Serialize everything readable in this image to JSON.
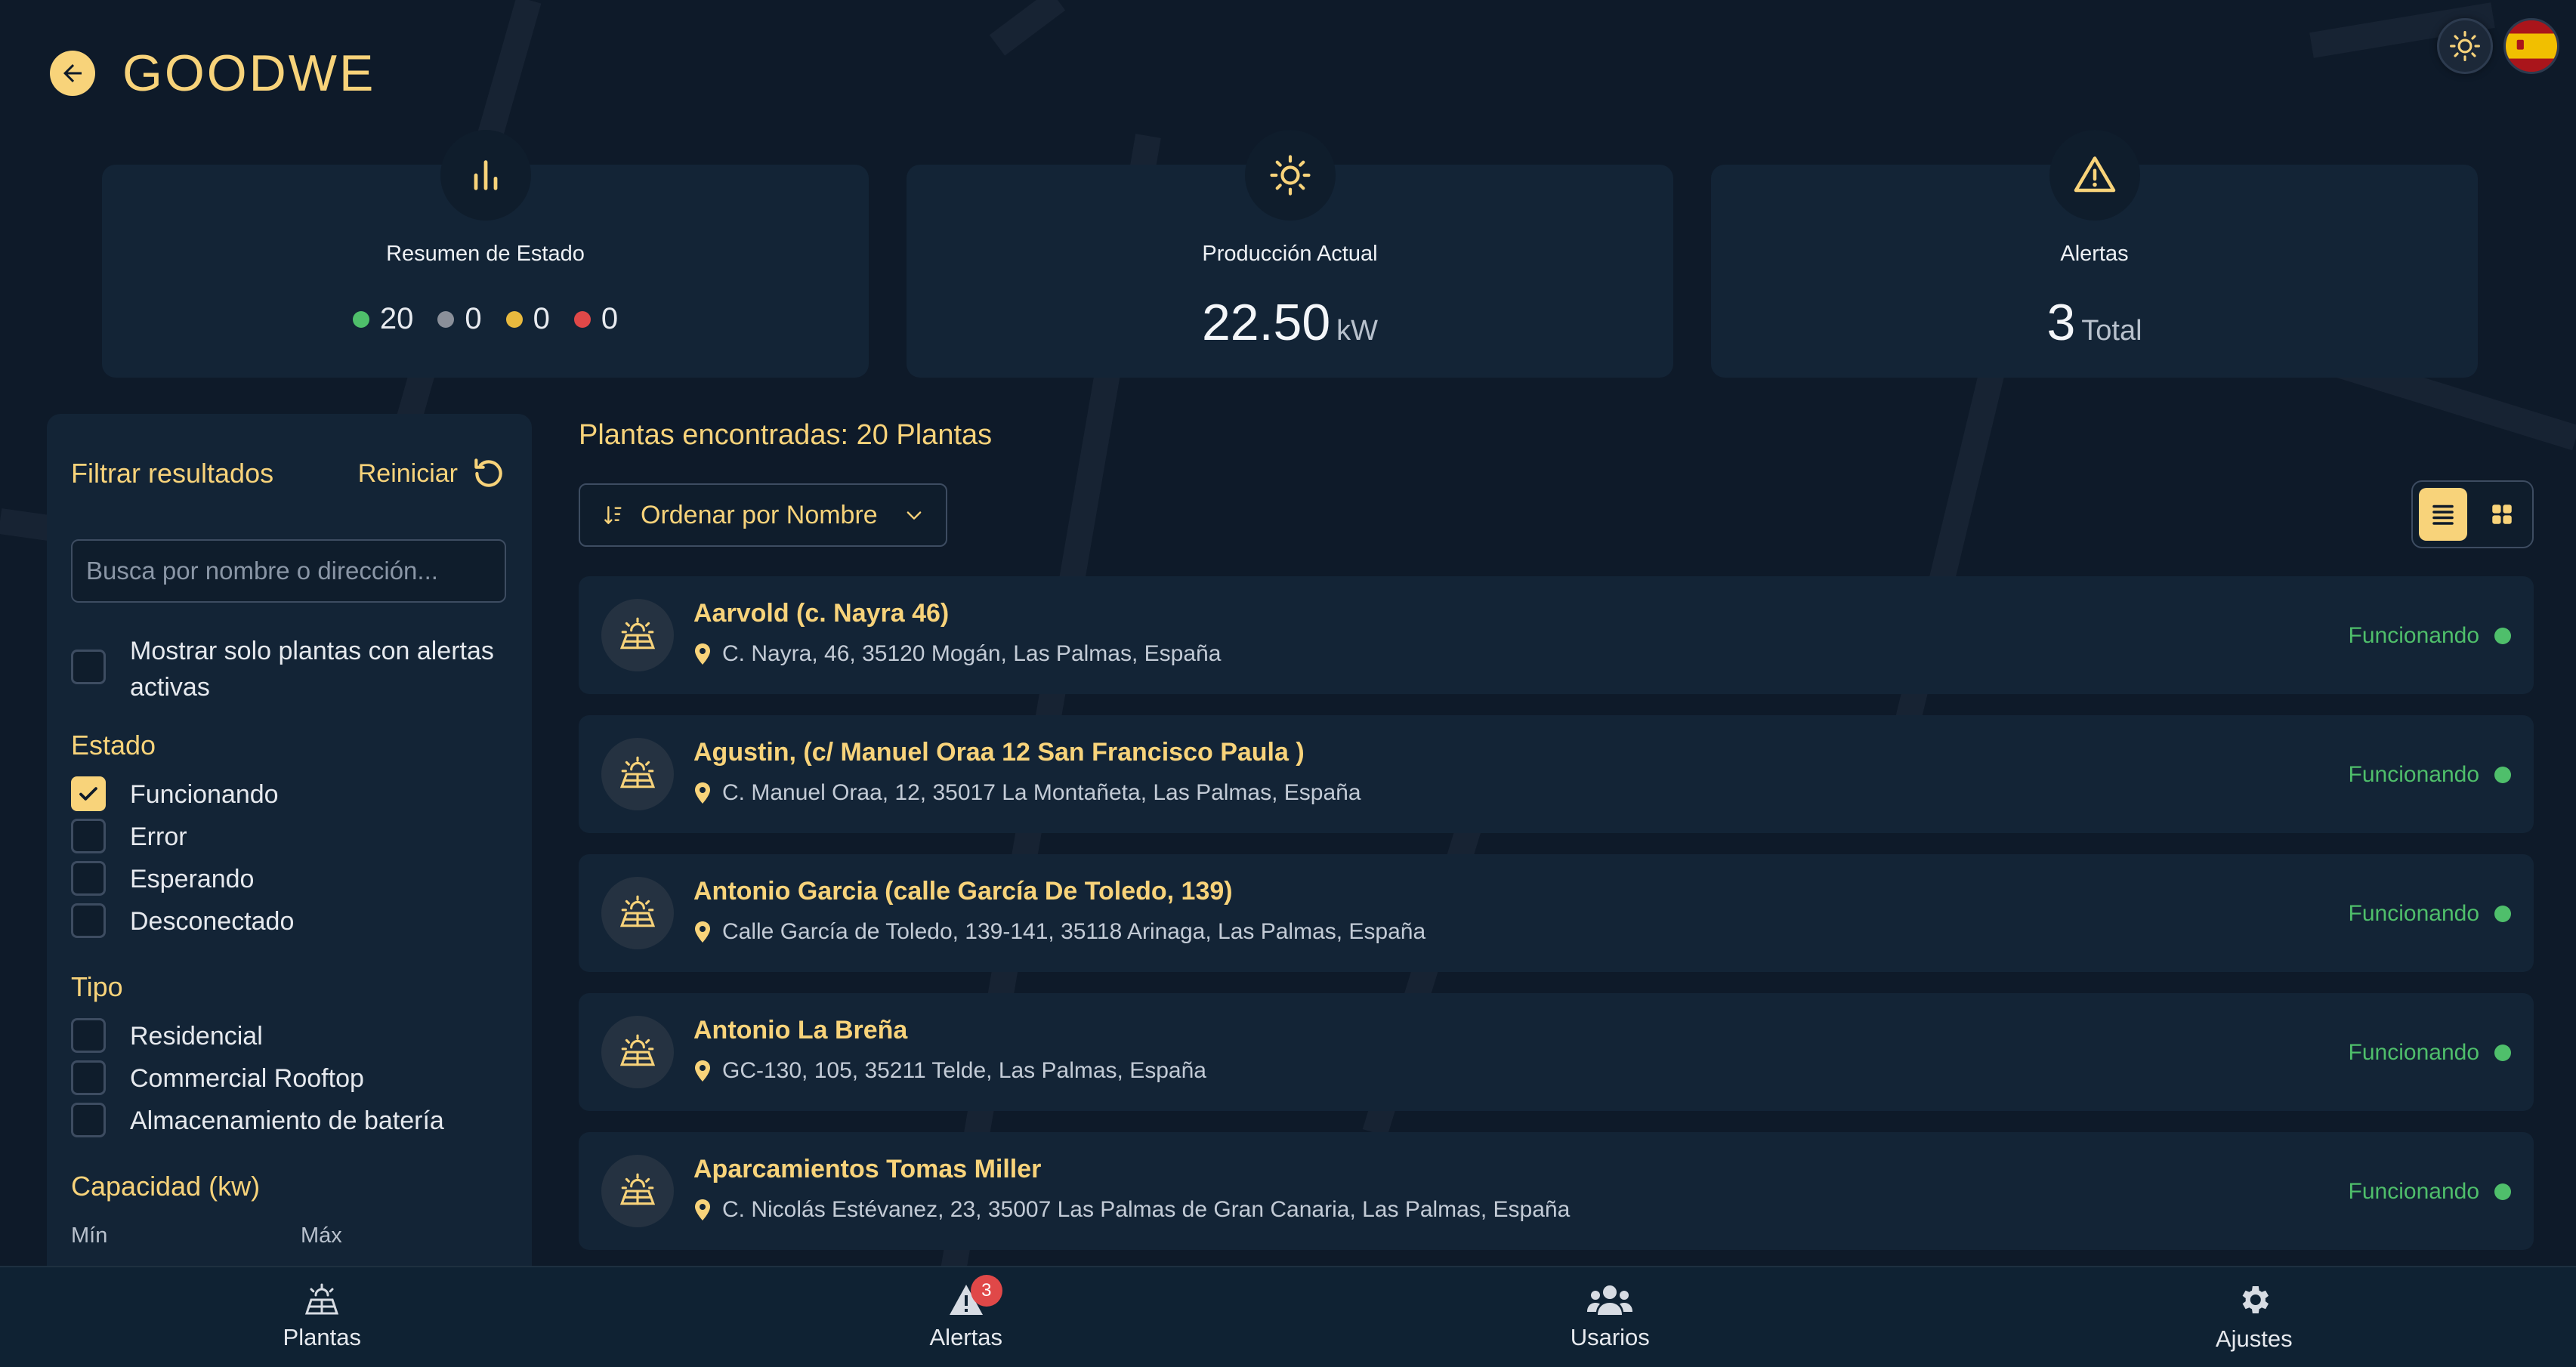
{
  "header": {
    "brand": "GOODWE",
    "back_icon": "arrow-left-icon"
  },
  "top_controls": {
    "theme_icon": "sun-icon",
    "language_flag": "spain-flag"
  },
  "stats": {
    "summary": {
      "title": "Resumen de Estado",
      "icon": "bar-chart-icon",
      "counts": [
        {
          "value": "20",
          "color": "#4fbf6b"
        },
        {
          "value": "0",
          "color": "#8a8f99"
        },
        {
          "value": "0",
          "color": "#e8b93e"
        },
        {
          "value": "0",
          "color": "#e04848"
        }
      ]
    },
    "production": {
      "title": "Producción Actual",
      "icon": "sun-icon",
      "value": "22.50",
      "unit": "kW"
    },
    "alerts": {
      "title": "Alertas",
      "icon": "warning-icon",
      "value": "3",
      "unit": "Total"
    }
  },
  "filters": {
    "title": "Filtrar resultados",
    "reset_label": "Reiniciar",
    "search_placeholder": "Busca por nombre o dirección...",
    "only_alerts_label_1": "Mostrar solo plantas con alertas",
    "only_alerts_label_2": "activas",
    "estado_title": "Estado",
    "estado_options": [
      {
        "label": "Funcionando",
        "checked": true
      },
      {
        "label": "Error",
        "checked": false
      },
      {
        "label": "Esperando",
        "checked": false
      },
      {
        "label": "Desconectado",
        "checked": false
      }
    ],
    "tipo_title": "Tipo",
    "tipo_options": [
      {
        "label": "Residencial",
        "checked": false
      },
      {
        "label": "Commercial Rooftop",
        "checked": false
      },
      {
        "label": "Almacenamiento de batería",
        "checked": false
      }
    ],
    "capacity_title": "Capacidad (kw)",
    "min_label": "Mín",
    "max_label": "Máx"
  },
  "results": {
    "found_label": "Plantas encontradas: 20 Plantas",
    "sort_label": "Ordenar por Nombre",
    "plants": [
      {
        "name": "Aarvold (c. Nayra 46)",
        "address": "C. Nayra, 46, 35120 Mogán, Las Palmas, España",
        "status": "Funcionando"
      },
      {
        "name": "Agustin, (c/ Manuel Oraa 12 San Francisco Paula )",
        "address": "C. Manuel Oraa, 12, 35017 La Montañeta, Las Palmas, España",
        "status": "Funcionando"
      },
      {
        "name": "Antonio Garcia (calle García De Toledo, 139)",
        "address": "Calle García de Toledo, 139-141, 35118 Arinaga, Las Palmas, España",
        "status": "Funcionando"
      },
      {
        "name": "Antonio La Breña",
        "address": "GC-130, 105, 35211 Telde, Las Palmas, España",
        "status": "Funcionando"
      },
      {
        "name": "Aparcamientos Tomas Miller",
        "address": "C. Nicolás Estévanez, 23, 35007 Las Palmas de Gran Canaria, Las Palmas, España",
        "status": "Funcionando"
      }
    ]
  },
  "nav": {
    "items": [
      {
        "label": "Plantas",
        "icon": "solar-panel-icon"
      },
      {
        "label": "Alertas",
        "icon": "warning-icon",
        "badge": "3"
      },
      {
        "label": "Usarios",
        "icon": "users-icon"
      },
      {
        "label": "Ajustes",
        "icon": "gear-icon"
      }
    ]
  },
  "colors": {
    "accent": "#f8d37a",
    "ok": "#4fbf6b",
    "error": "#e04848",
    "background": "#0e1a29",
    "card": "#132436"
  }
}
